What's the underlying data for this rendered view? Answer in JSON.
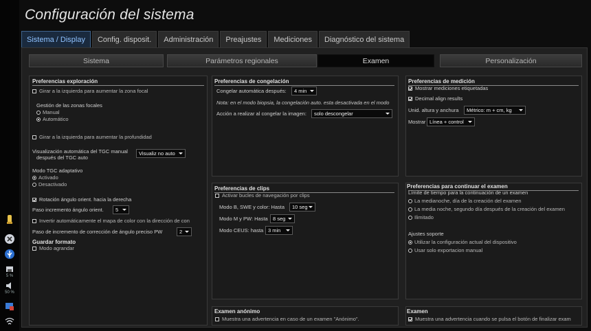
{
  "title": "Configuración del sistema",
  "tabs": [
    "Sistema / Display",
    "Config. disposit.",
    "Administración",
    "Preajustes",
    "Mediciones",
    "Diagnóstico del sistema"
  ],
  "subtabs": [
    "Sistema",
    "Parámetros regionales",
    "Examen",
    "Personalización"
  ],
  "sidebar": {
    "volume_pct": "5 %",
    "brightness_pct": "50 %"
  },
  "exploracion": {
    "title": "Preferencias exploración",
    "girar_zona_focal": "Girar a la izquierda para aumentar la zona focal",
    "gestion_label": "Gestión de las zonas focales",
    "gestion_manual": "Manual",
    "gestion_auto": "Automático",
    "girar_profundidad": "Girar a la izquierda para aumentar la profundidad",
    "vis_tgc_line1": "Visualización automática del TGC manual",
    "vis_tgc_line2": "después del TGC auto",
    "vis_tgc_value": "Visualiz no auto",
    "modo_tgc_label": "Modo TGC adaptativo",
    "modo_tgc_on": "Activado",
    "modo_tgc_off": "Desactivado",
    "rotacion": "Rotación ángulo orient. hacia la derecha",
    "paso_incremento": "Paso incremento ángulo orient.",
    "paso_incremento_value": "5",
    "invertir_mapa": "Invertir automáticamente el mapa de color con la dirección de con",
    "paso_pw": "Paso de incremento de corrección de ángulo preciso PW",
    "paso_pw_value": "2"
  },
  "guardar": {
    "title": "Guardar formato",
    "modo_agrandar": "Modo agrandar"
  },
  "congelacion": {
    "title": "Preferencias de congelación",
    "auto_label": "Congelar automática después:",
    "auto_value": "4 min",
    "nota": "Nota: en el modo biopsia, la congelación auto. esta desactivada en el modo",
    "accion_label": "Acción a realizar al congelar la imagen:",
    "accion_value": "solo descongelar"
  },
  "clips": {
    "title": "Preferencias de clips",
    "activar": "Activar bucles de navegación por clips",
    "modo_b_label": "Modo B, SWE y color: Hasta",
    "modo_b_value": "10 seg",
    "modo_m_label": "Modo M y PW: Hasta",
    "modo_m_value": "8 seg",
    "ceus_label": "Modo CEUS: hasta",
    "ceus_value": "3 min"
  },
  "anonimo": {
    "title": "Examen anónimo",
    "advertencia": "Muestra una advertencia en caso de un examen \"Anónimo\"."
  },
  "medicion": {
    "title": "Preferencias de medición",
    "mostrar_etiquetadas": "Mostrar mediciones etiquetadas",
    "decimal_align": "Decimal align results",
    "unid_label": "Unid. altura y anchura",
    "unid_value": "Métrico: m + cm, kg",
    "mostrar_label": "Mostrar",
    "mostrar_value": "Línea + control"
  },
  "continuar": {
    "title": "Preferencias para continuar el examen",
    "limite_label": "Límite de tiempo para la continuación de un examen",
    "opt1": "La medianoche, día de la creación del examen",
    "opt2": "La media noche, segundo día después de la creación del examen",
    "opt3": "Ilimitado",
    "ajustes_label": "Ajustes soporte",
    "ajustes_opt1": "Utilizar la configuración actual del dispositivo",
    "ajustes_opt2": "Usar solo exportacion manual"
  },
  "examen": {
    "title": "Examen",
    "advertencia": "Muestra una advertencia cuando se pulsa el botón de finalizar exam"
  }
}
